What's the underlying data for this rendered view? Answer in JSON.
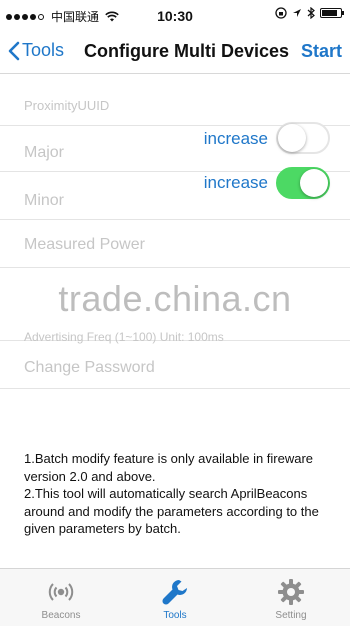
{
  "status_bar": {
    "carrier": "中国联通",
    "time": "10:30",
    "battery_level": 0.85,
    "signal_bars": 4
  },
  "navbar": {
    "back_label": "Tools",
    "title": "Configure Multi Devices",
    "action_label": "Start"
  },
  "form": {
    "uuid_placeholder": "ProximityUUID",
    "major_placeholder": "Major",
    "major_toggle_label": "increase",
    "major_toggle_on": false,
    "minor_placeholder": "Minor",
    "minor_toggle_label": "increase",
    "minor_toggle_on": true,
    "power_placeholder": "Measured Power",
    "freq_placeholder": "Advertising Freq (1~100) Unit: 100ms",
    "password_placeholder": "Change Password"
  },
  "watermark": "trade.china.cn",
  "notes": {
    "line1": "1.Batch modify feature is only available in fireware version 2.0 and above.",
    "line2": "2.This tool will automatically search AprilBeacons around and modify the parameters according to the given parameters by batch."
  },
  "tabbar": {
    "items": [
      {
        "label": "Beacons",
        "icon": "beacon-icon",
        "active": false
      },
      {
        "label": "Tools",
        "icon": "wrench-icon",
        "active": true
      },
      {
        "label": "Setting",
        "icon": "gear-icon",
        "active": false
      }
    ]
  },
  "colors": {
    "accent": "#1f77c9",
    "switch_on": "#4cd964",
    "placeholder": "#c6c6c6"
  }
}
